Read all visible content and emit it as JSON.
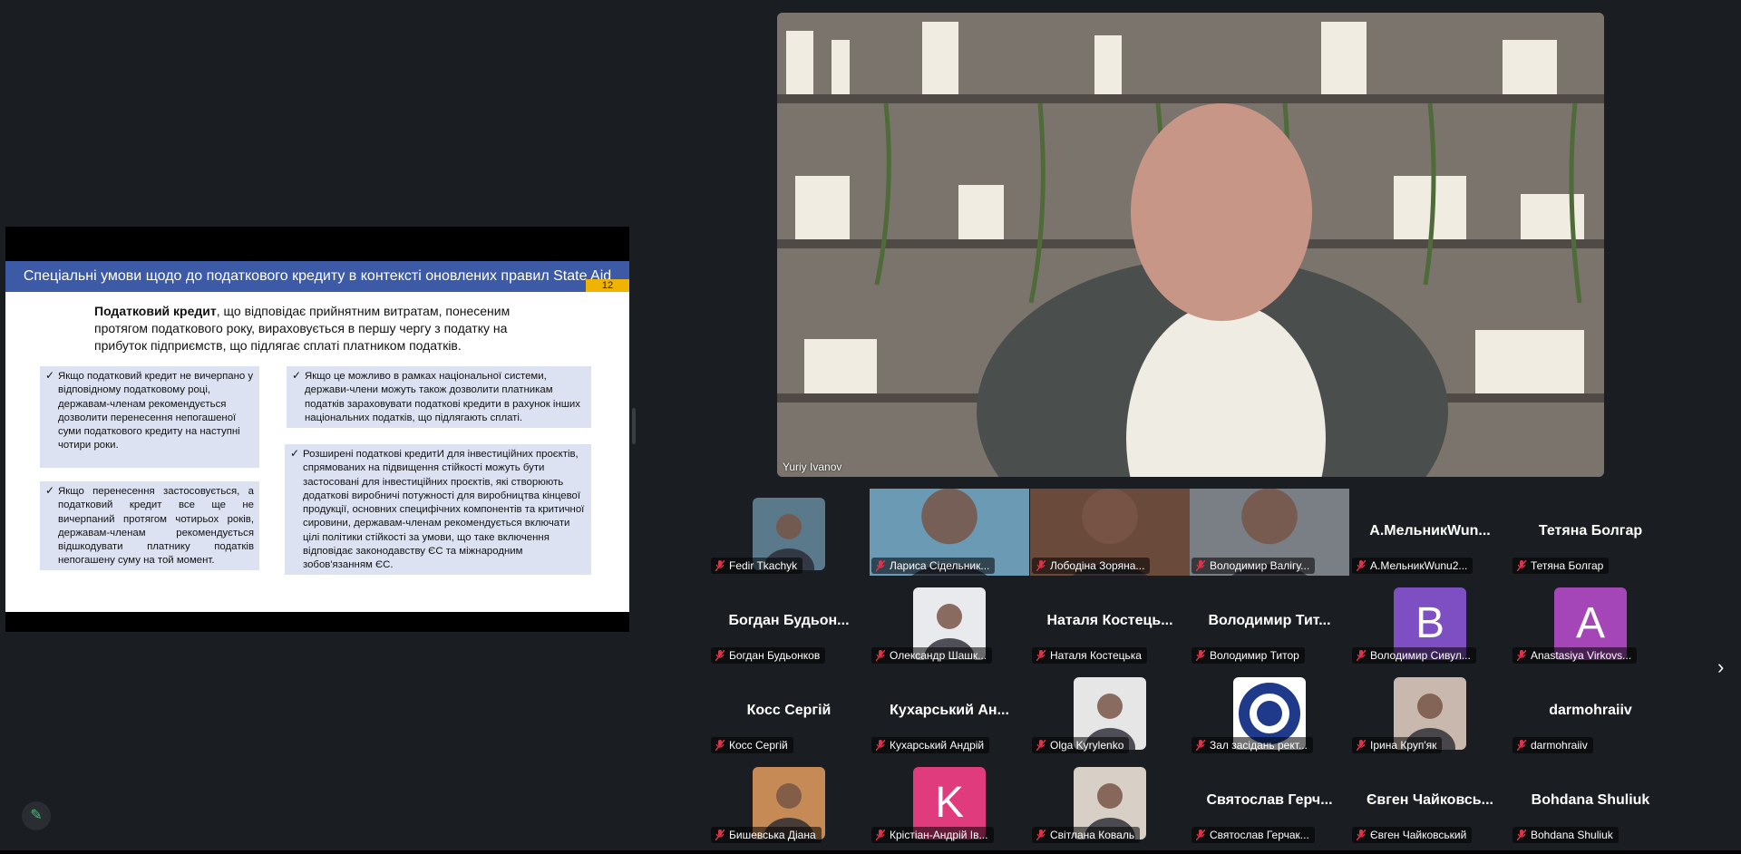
{
  "slide": {
    "title": "Спеціальні умови щодо до податкового кредиту в контексті оновлених правил State Aid",
    "page_number": "12",
    "intro_bold": "Податковий кредит",
    "intro_rest": ", що відповідає прийнятним витратам, понесеним протягом податкового року, вираховується в першу чергу з податку на прибуток підприємств, що підлягає сплаті платником податків.",
    "box1": "Якщо податковий кредит не вичерпано у відповідному податковому році, державам-членам рекомендується дозволити перенесення непогашеної суми податкового кредиту на наступні чотири роки.",
    "box2": "Якщо перенесення застосовується, а податковий кредит все ще не вичерпаний протягом чотирьох років, державам-членам рекомендується відшкодувати платнику податків непогашену суму на той момент.",
    "box3": "Якщо це можливо в рамках національної системи, держави-члени можуть також дозволити платникам податків зараховувати податкові кредити в рахунок інших національних податків, що підлягають сплаті.",
    "box4": "Розширені податкові кредитИ для інвестиційних проєктів, спрямованих на підвищення стійкості можуть бути застосовані для інвестиційних проєктів, які створюють додаткові виробничі потужності для виробництва кінцевої продукції, основних специфічних компонентів та критичної сировини, державам-членам рекомендується включати цілі політики стійкості за умови, що таке включення відповідає законодавству ЄС та міжнародним зобов'язанням ЄС.",
    "check_glyph": "✓"
  },
  "speaker": {
    "name": "Yuriy Ivanov"
  },
  "participants": [
    {
      "label": "Fedir Tkachyk",
      "center": "",
      "kind": "photo",
      "color": "#5a7a8c"
    },
    {
      "label": "Лариса Сідельник...",
      "center": "",
      "kind": "video",
      "color": "#6a9ab4"
    },
    {
      "label": "Лободіна Зоряна...",
      "center": "",
      "kind": "video",
      "color": "#6a4a3a"
    },
    {
      "label": "Володимир Валігу...",
      "center": "",
      "kind": "video",
      "color": "#7a7f86"
    },
    {
      "label": "А.МельникWunu2...",
      "center": "А.МельникWun...",
      "kind": "name"
    },
    {
      "label": "Тетяна Болгар",
      "center": "Тетяна Болгар",
      "kind": "name"
    },
    {
      "label": "Богдан Будьонков",
      "center": "Богдан Будьон...",
      "kind": "name"
    },
    {
      "label": "Олександр Шашк...",
      "center": "",
      "kind": "photo",
      "color": "#e8eaee"
    },
    {
      "label": "Наталя Костецька",
      "center": "Наталя Костець...",
      "kind": "name"
    },
    {
      "label": "Володимир Титор",
      "center": "Володимир Тит...",
      "kind": "name"
    },
    {
      "label": "Володимир Сивул...",
      "center": "",
      "kind": "letter",
      "letter": "B",
      "color": "#7e4fc2"
    },
    {
      "label": "Anastasiya Virkovs...",
      "center": "",
      "kind": "letter",
      "letter": "A",
      "color": "#a546b8"
    },
    {
      "label": "Косс Сергій",
      "center": "Косс Сергій",
      "kind": "name"
    },
    {
      "label": "Кухарський Андрій",
      "center": "Кухарський Ан...",
      "kind": "name"
    },
    {
      "label": "Olga Kyrylenko",
      "center": "",
      "kind": "photo",
      "color": "#e6e6e6"
    },
    {
      "label": "Зал засідань рект...",
      "center": "",
      "kind": "logo",
      "color": "#ffffff"
    },
    {
      "label": "Ірина Круп'як",
      "center": "",
      "kind": "photo",
      "color": "#c9b8ad"
    },
    {
      "label": "darmohraiiv",
      "center": "darmohraiiv",
      "kind": "name"
    },
    {
      "label": "Бишевська Діана",
      "center": "",
      "kind": "photo",
      "color": "#c58a55"
    },
    {
      "label": "Крістіан-Андрій Ів...",
      "center": "",
      "kind": "letter",
      "letter": "K",
      "color": "#e03c7d"
    },
    {
      "label": "Світлана Коваль",
      "center": "",
      "kind": "photo",
      "color": "#d8cfc6"
    },
    {
      "label": "Святослав Герчак...",
      "center": "Святослав Герч...",
      "kind": "name"
    },
    {
      "label": "Євген Чайковський",
      "center": "Євген Чайковсь...",
      "kind": "name"
    },
    {
      "label": "Bohdana Shuliuk",
      "center": "Bohdana Shuliuk",
      "kind": "name"
    }
  ],
  "controls": {
    "next_page_glyph": "›",
    "annotate_glyph": "✎"
  },
  "colors": {
    "background": "#1a1d21",
    "slide_header": "#3c5aa6",
    "slide_box": "#dde2f2",
    "page_badge": "#f0b400",
    "muted_mic": "#e0334a",
    "annotate_accent": "#2ecc71"
  }
}
